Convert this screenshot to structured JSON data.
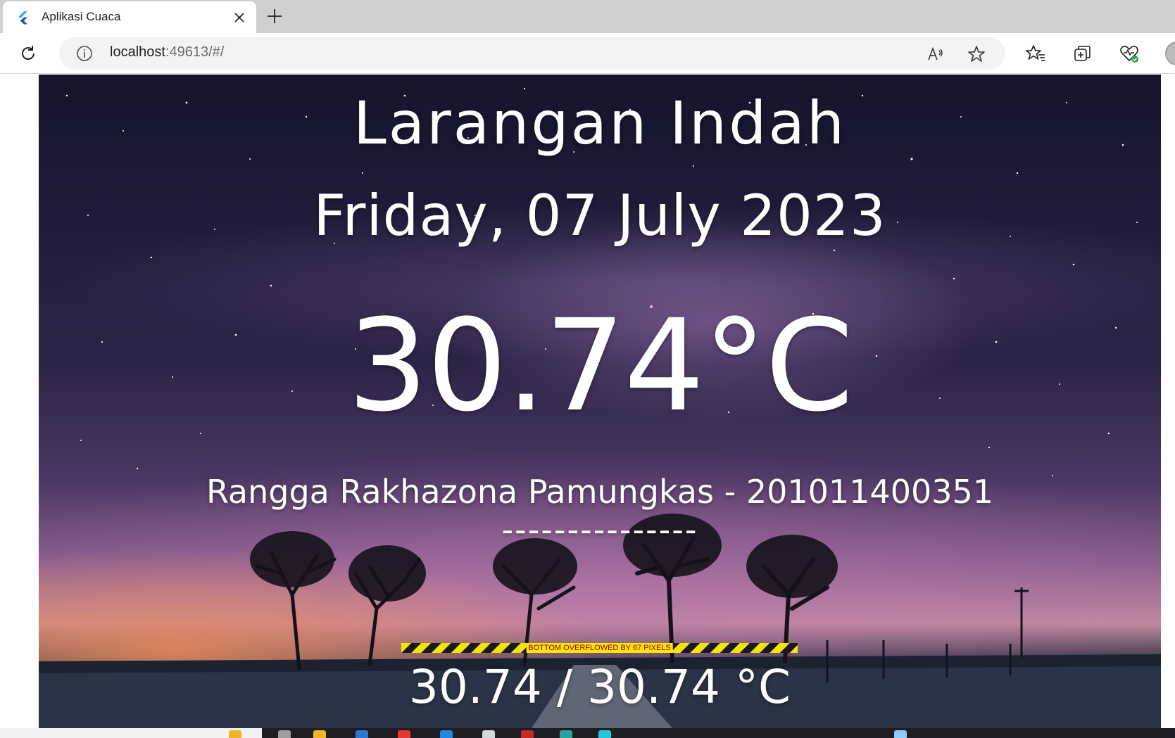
{
  "browser": {
    "tab_title": "Aplikasi Cuaca",
    "url_host": "localhost",
    "url_rest": ":49613/#/",
    "icons": [
      "flutter-icon",
      "close-icon",
      "plus-icon",
      "reload-icon",
      "info-icon",
      "read-aloud-icon",
      "star-icon",
      "favorites-icon",
      "collections-icon",
      "browser-essentials-icon",
      "profile-icon"
    ]
  },
  "weather": {
    "city": "Larangan Indah",
    "date": "Friday, 07 July 2023",
    "temperature": "30.74°C",
    "author": "Rangga Rakhazona Pamungkas - 201011400351",
    "divider": "---------------",
    "min_max": "30.74 / 30.74 °C"
  },
  "debug": {
    "overflow_message": "BOTTOM OVERFLOWED BY 67 PIXELS"
  },
  "colors": {
    "text": "#ffffff",
    "overflow_yellow": "#ffe600",
    "overflow_text": "#8b0000"
  }
}
